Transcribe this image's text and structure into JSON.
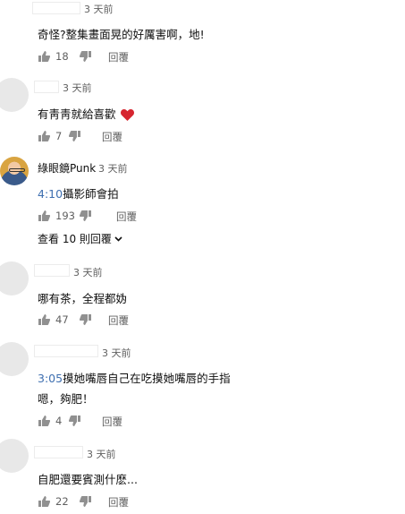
{
  "comments": [
    {
      "author": "",
      "time": "3 天前",
      "text": "奇怪?整集畫面晃的好厲害啊，地!",
      "likes": "18",
      "reply_label": "回覆"
    },
    {
      "author": "",
      "time": "3 天前",
      "text": "有靑靑就給喜歡",
      "emoji": "heart",
      "likes": "7",
      "reply_label": "回覆"
    },
    {
      "author": "綠眼鏡Punk",
      "time": "3 天前",
      "timestamp": "4:10",
      "text": "攝影師會拍",
      "likes": "193",
      "reply_label": "回覆",
      "view_replies": "查看 10 則回覆"
    },
    {
      "author": "",
      "time": "3 天前",
      "text": "哪有茶，全程都妫",
      "likes": "47",
      "reply_label": "回覆"
    },
    {
      "author": "",
      "time": "3 天前",
      "timestamp": "3:05",
      "text": "摸她嘴唇自己在吃摸她嘴唇的手指",
      "text2": "嗯，夠肥！",
      "likes": "4",
      "reply_label": "回覆"
    },
    {
      "author": "",
      "time": "3 天前",
      "text": "自肥還要賓測什麽...",
      "likes": "22",
      "reply_label": "回覆"
    }
  ],
  "colors": {
    "timestamp_link": "#3e6fb0",
    "heart": "#d6252f",
    "muted": "#606060"
  }
}
